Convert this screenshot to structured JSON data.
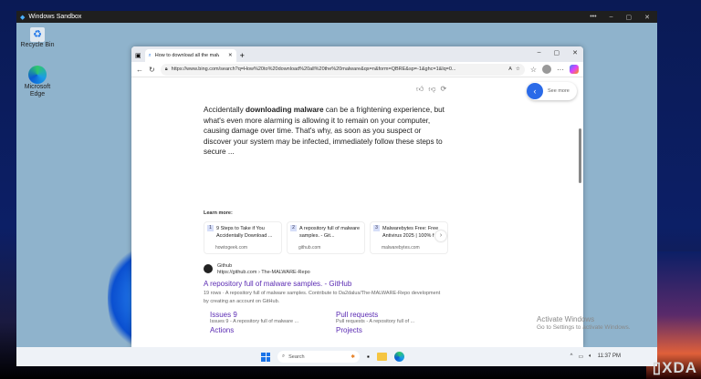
{
  "sandbox": {
    "title": "Windows Sandbox",
    "more": "•••"
  },
  "desktop": {
    "icons": [
      {
        "label": "Recycle Bin"
      },
      {
        "label": "Microsoft Edge"
      }
    ]
  },
  "browser": {
    "tab_title": "How to download all the malware",
    "url": "https://www.bing.com/search?q=How%20to%20download%20all%20the%20malware&qs=n&form=QBRE&sp=-1&ghc=1&lq=0...",
    "see_more": "See more",
    "answer_pre": "Accidentally ",
    "answer_bold": "downloading malware",
    "answer_post": " can be a frightening experience, but what's even more alarming is allowing it to remain on your computer, causing damage over time. That's why, as soon as you suspect or discover your system may be infected, immediately follow these steps to secure ...",
    "learn_more": "Learn more:",
    "cards": [
      {
        "n": "1",
        "title": "9 Steps to Take if You Accidentally Download ...",
        "source": "howtogeek.com"
      },
      {
        "n": "2",
        "title": "A repository full of malware samples. - Git...",
        "source": "github.com"
      },
      {
        "n": "3",
        "title": "Malwarebytes Free: Free Antivirus 2025 | 100% f",
        "source": "malwarebytes.com"
      }
    ],
    "result": {
      "site": "Github",
      "url": "https://github.com › The-MALWARE-Repo",
      "title": "A repository full of malware samples. - GitHub",
      "snippet": "19 rows · A repository full of malware samples. Contribute to Da2dalus/The-MALWARE-Repo development by creating an account on GitHub.",
      "links": [
        {
          "title": "Issues 9",
          "desc": "Issues 9 - A repository full of malware ..."
        },
        {
          "title": "Pull requests",
          "desc": "Pull requests - A repository full of ..."
        },
        {
          "title": "Actions",
          "desc": ""
        },
        {
          "title": "Projects",
          "desc": ""
        }
      ]
    },
    "activate_title": "Activate Windows",
    "activate_sub": "Go to Settings to activate Windows."
  },
  "taskbar": {
    "search": "Search",
    "clock": "11:37 PM"
  },
  "watermark": "XDA"
}
